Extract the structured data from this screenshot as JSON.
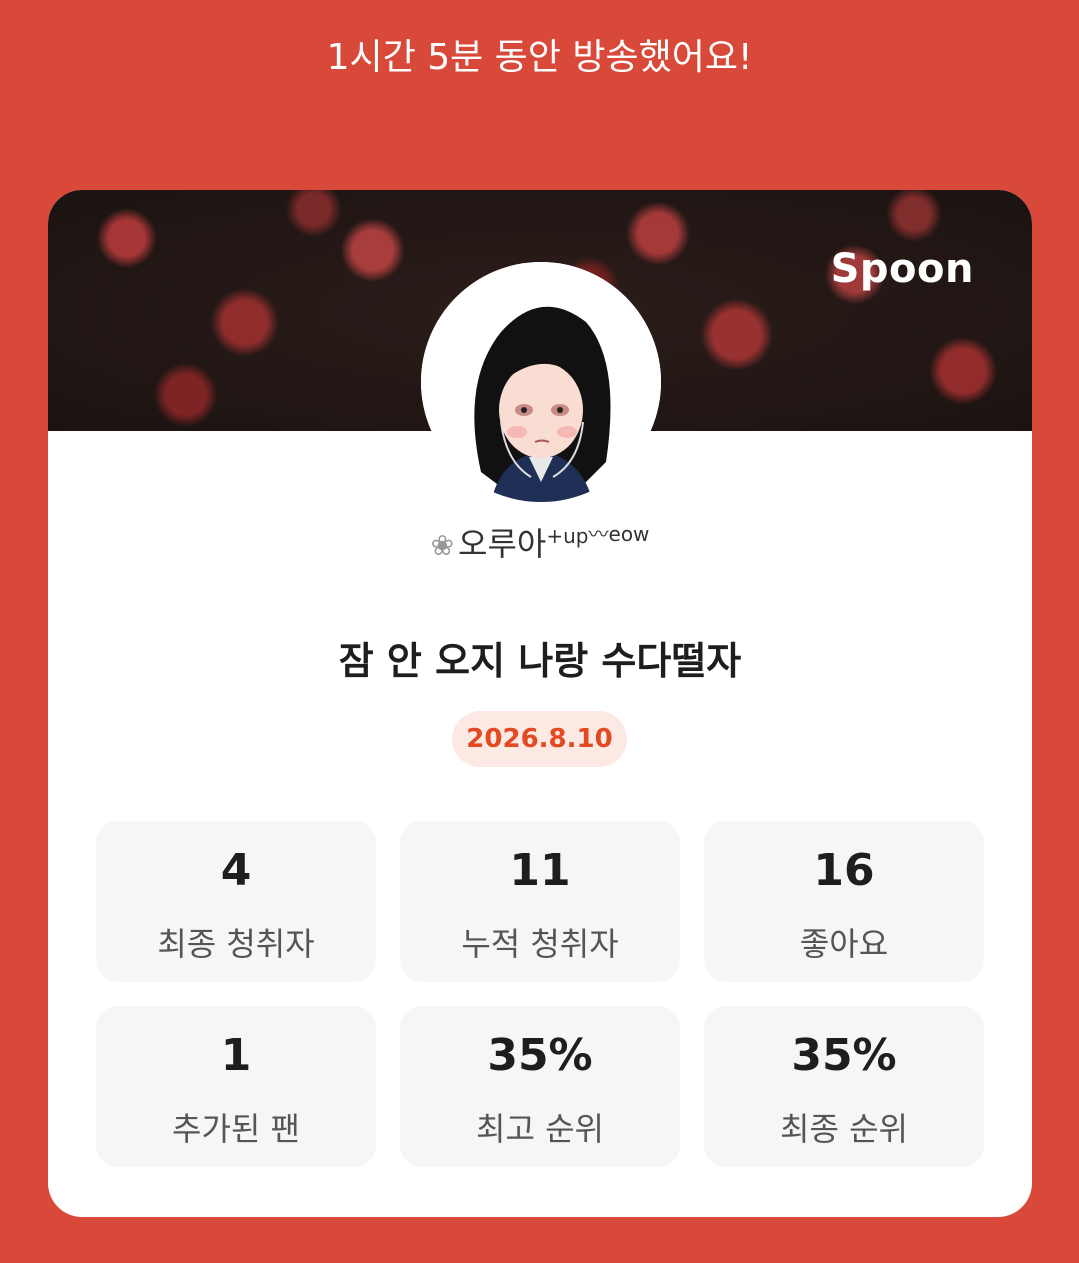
{
  "header": {
    "message": "1시간 5분 동안 방송했어요!"
  },
  "card": {
    "brand": "Spoon",
    "nickname": {
      "main": "오루아",
      "sup": "+up",
      "tail": "eow"
    },
    "title": "잠 안 오지 나랑 수다떨자",
    "date": "2026.8.10",
    "stats": [
      {
        "value": "4",
        "label": "최종 청취자"
      },
      {
        "value": "11",
        "label": "누적 청취자"
      },
      {
        "value": "16",
        "label": "좋아요"
      },
      {
        "value": "1",
        "label": "추가된 팬"
      },
      {
        "value": "35%",
        "label": "최고 순위"
      },
      {
        "value": "35%",
        "label": "최종 순위"
      }
    ]
  },
  "colors": {
    "background": "#d9493a",
    "card": "#ffffff",
    "date_badge_bg": "#fde9e3",
    "date_badge_text": "#e24a22",
    "stat_bg": "#f6f6f6"
  }
}
